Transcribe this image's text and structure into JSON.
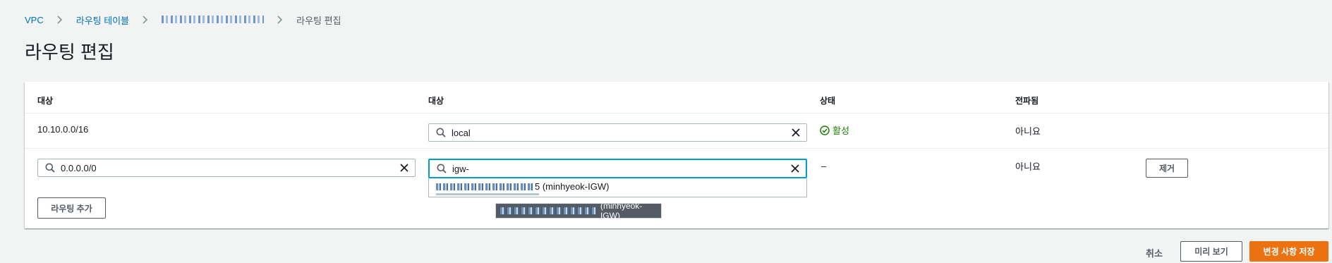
{
  "breadcrumb": {
    "items": [
      {
        "label": "VPC"
      },
      {
        "label": "라우팅 테이블"
      },
      {
        "label": ""
      },
      {
        "label": "라우팅 편집"
      }
    ]
  },
  "page": {
    "title": "라우팅 편집"
  },
  "table": {
    "headers": [
      "대상",
      "대상",
      "상태",
      "전파됨"
    ],
    "rows": [
      {
        "destination": "10.10.0.0/16",
        "target": "local",
        "status": "활성",
        "propagated": "아니요"
      },
      {
        "destination": "0.0.0.0/0",
        "target": "igw-",
        "status": "–",
        "propagated": "아니요",
        "remove": "제거"
      }
    ]
  },
  "dropdown": {
    "option_suffix": "5 (minhyeok-IGW)"
  },
  "tooltip": {
    "suffix": "(minhyeok-IGW)"
  },
  "buttons": {
    "add_route": "라우팅 추가",
    "cancel": "취소",
    "preview": "미리 보기",
    "save": "변경 사항 저장"
  },
  "colors": {
    "link": "#0073bb",
    "success": "#1d8102",
    "primary": "#ec7211",
    "focus": "#00a1c9"
  },
  "icons": [
    "chevron-right-icon",
    "search-icon",
    "clear-icon",
    "status-success-icon"
  ]
}
